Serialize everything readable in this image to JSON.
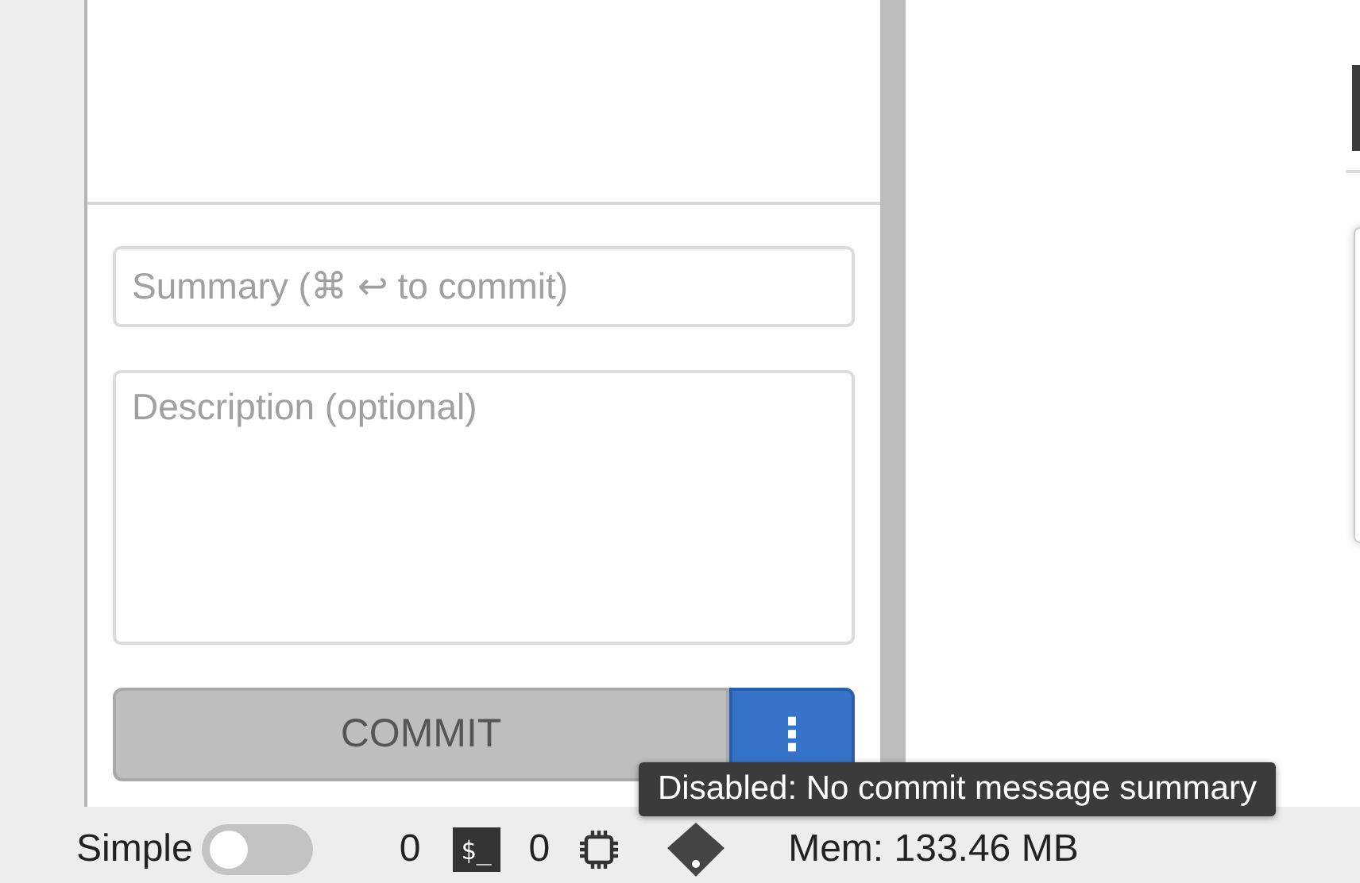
{
  "commit_form": {
    "summary": {
      "placeholder": "Summary (⌘ ↩ to commit)"
    },
    "description": {
      "placeholder": "Description (optional)"
    },
    "commit_button": {
      "label": "COMMIT",
      "disabled": true
    },
    "more_button": {
      "label": "⋮"
    }
  },
  "status_bar": {
    "simple_mode": {
      "label": "Simple",
      "on": false
    },
    "count_1": "0",
    "terminal_label": "$_",
    "count_2": "0",
    "memory": "Mem: 133.46 MB"
  },
  "tooltip": {
    "text": "Disabled: No commit message summary"
  }
}
